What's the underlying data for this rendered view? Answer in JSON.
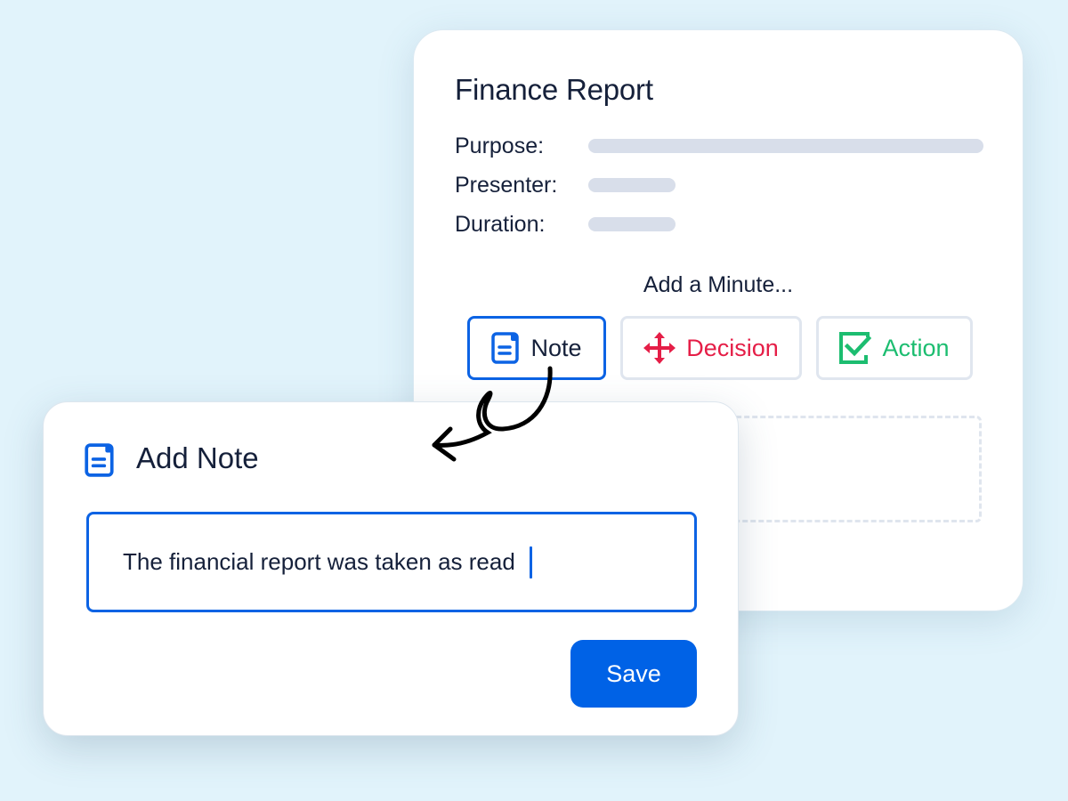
{
  "meeting_card": {
    "title": "Finance Report",
    "fields": [
      {
        "label": "Purpose:"
      },
      {
        "label": "Presenter:"
      },
      {
        "label": "Duration:"
      }
    ],
    "add_minute_label": "Add a Minute...",
    "minute_types": [
      {
        "label": "Note",
        "icon": "note-icon",
        "color": "#0c63e4",
        "selected": true
      },
      {
        "label": "Decision",
        "icon": "move-arrows-icon",
        "color": "#e51e47",
        "selected": false
      },
      {
        "label": "Action",
        "icon": "checkbox-check-icon",
        "color": "#1cbd70",
        "selected": false
      }
    ]
  },
  "add_note_dialog": {
    "title": "Add Note",
    "icon": "note-icon",
    "input_value": "The financial report was taken as read",
    "save_label": "Save"
  },
  "colors": {
    "accent": "#0062e6",
    "background": "#e1f3fb",
    "placeholder_bar": "#d8deea"
  }
}
